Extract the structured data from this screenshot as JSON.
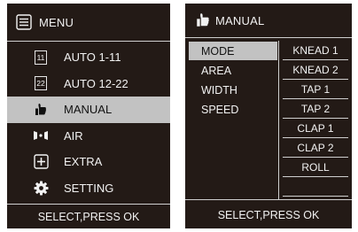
{
  "left_screen": {
    "title": "MENU",
    "items": [
      {
        "label": "AUTO 1-11",
        "icon": "calendar-11-icon",
        "icon_text": "11",
        "selected": false
      },
      {
        "label": "AUTO 12-22",
        "icon": "calendar-22-icon",
        "icon_text": "22",
        "selected": false
      },
      {
        "label": "MANUAL",
        "icon": "thumbs-up-icon",
        "selected": true
      },
      {
        "label": "AIR",
        "icon": "air-icon",
        "selected": false
      },
      {
        "label": "EXTRA",
        "icon": "plus-box-icon",
        "selected": false
      },
      {
        "label": "SETTING",
        "icon": "gear-icon",
        "selected": false
      }
    ],
    "footer": "SELECT,PRESS OK"
  },
  "right_screen": {
    "title": "MANUAL",
    "title_icon": "thumbs-up-icon",
    "categories": [
      {
        "label": "MODE",
        "selected": true
      },
      {
        "label": "AREA",
        "selected": false
      },
      {
        "label": "WIDTH",
        "selected": false
      },
      {
        "label": "SPEED",
        "selected": false
      }
    ],
    "modes": [
      "KNEAD 1",
      "KNEAD 2",
      "TAP 1",
      "TAP 2",
      "CLAP 1",
      "CLAP 2",
      "ROLL"
    ],
    "footer": "SELECT,PRESS OK"
  },
  "colors": {
    "screen_bg": "#231a16",
    "highlight": "#c2c2c2",
    "text": "#f2f2f2"
  }
}
